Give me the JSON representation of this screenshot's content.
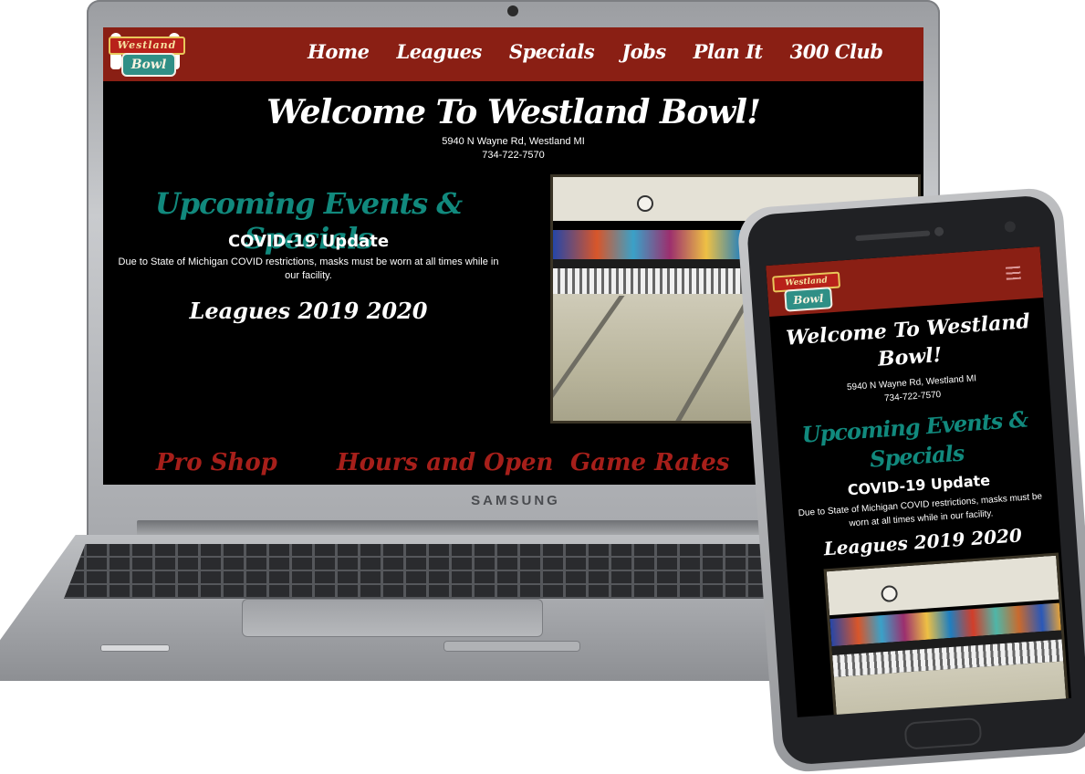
{
  "site": {
    "brand_top": "Westland",
    "brand_bottom": "Bowl",
    "nav": [
      "Home",
      "Leagues",
      "Specials",
      "Jobs",
      "Plan It",
      "300 Club"
    ],
    "welcome": "Welcome To Westland Bowl!",
    "address": "5940 N Wayne Rd, Westland MI",
    "phone": "734-722-7570",
    "events_heading": "Upcoming Events & Specials",
    "covid_heading": "COVID-19 Update",
    "covid_text": "Due to State of Michigan COVID restrictions, masks must be worn at all times while in our facility.",
    "leagues_heading": "Leagues 2019 2020",
    "bottom_sections": [
      "Pro Shop",
      "Hours and Open",
      "Game Rates"
    ],
    "colors": {
      "nav_red": "#8a1f14",
      "teal": "#11897d",
      "red_heading": "#a61f1a"
    }
  },
  "device": {
    "laptop_brand": "SAMSUNG"
  }
}
